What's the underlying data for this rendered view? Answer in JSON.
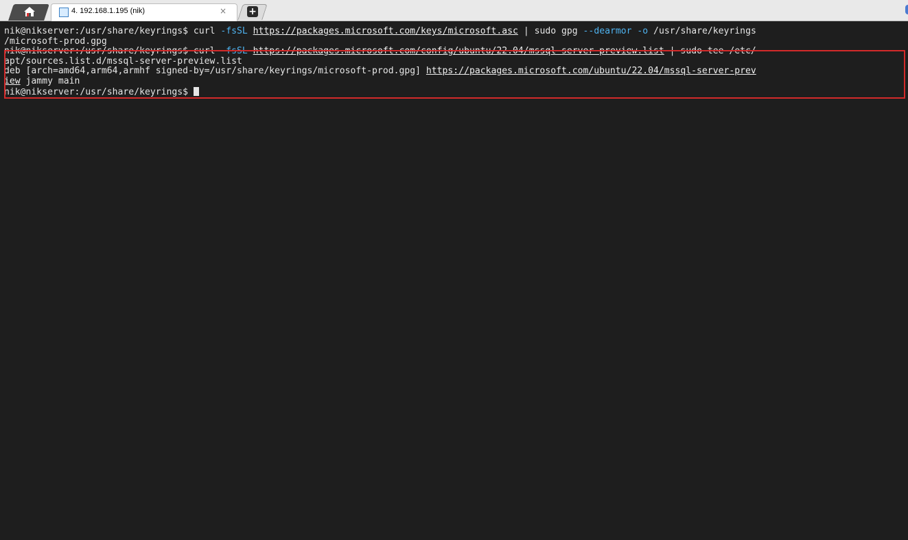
{
  "tabs": {
    "home_icon": "home-icon",
    "active_session_label": "4. 192.168.1.195 (nik)",
    "close_symbol": "×",
    "new_tab_symbol": "+"
  },
  "terminal": {
    "line1_prompt": "nik@nikserver:/usr/share/keyrings$ ",
    "line1_cmd": "curl ",
    "line1_flag": "-fsSL",
    "line1_url": "https://packages.microsoft.com/keys/microsoft.asc",
    "line1_mid": " | sudo gpg ",
    "line1_flag2": "--dearmor",
    "line1_flag3": "-o",
    "line1_end": " /usr/share/keyrings",
    "line2": "/microsoft-prod.gpg",
    "line3_prompt": "nik@nikserver:/usr/share/keyrings$ ",
    "line3_cmd": "curl ",
    "line3_flag": "-fsSL",
    "line3_url": "https://packages.microsoft.com/config/ubuntu/22.04/mssql-server-preview.list",
    "line3_end": " | sudo tee /etc/",
    "line4": "apt/sources.list.d/mssql-server-preview.list",
    "line5_text": "deb [arch=amd64,arm64,armhf signed-by=/usr/share/keyrings/microsoft-prod.gpg] ",
    "line5_url": "https://packages.microsoft.com/ubuntu/22.04/mssql-server-prev",
    "line6_url": "iew",
    "line6_text": " jammy main",
    "line7_prompt": "nik@nikserver:/usr/share/keyrings$ "
  },
  "colors": {
    "background": "#1e1e1e",
    "text": "#e6e6e6",
    "flag": "#4fb3f0",
    "highlight_border": "#d42a2a"
  }
}
